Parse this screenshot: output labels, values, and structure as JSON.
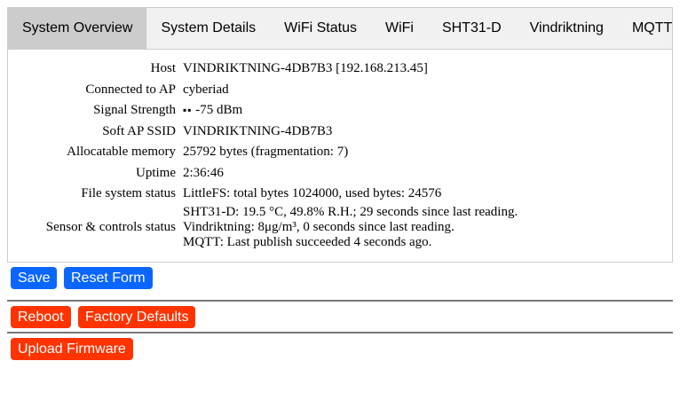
{
  "tabs": [
    {
      "label": "System Overview",
      "active": true
    },
    {
      "label": "System Details",
      "active": false
    },
    {
      "label": "WiFi Status",
      "active": false
    },
    {
      "label": "WiFi",
      "active": false
    },
    {
      "label": "SHT31-D",
      "active": false
    },
    {
      "label": "Vindriktning",
      "active": false
    },
    {
      "label": "MQTT",
      "active": false
    }
  ],
  "overview": {
    "host_label": "Host",
    "host_value": "VINDRIKTNING-4DB7B3 [192.168.213.45]",
    "ap_label": "Connected to AP",
    "ap_value": "cyberiad",
    "signal_label": "Signal Strength",
    "signal_bars": "▪▪",
    "signal_value": "-75 dBm",
    "ssid_label": "Soft AP SSID",
    "ssid_value": "VINDRIKTNING-4DB7B3",
    "memory_label": "Allocatable memory",
    "memory_value": "25792 bytes (fragmentation: 7)",
    "uptime_label": "Uptime",
    "uptime_value": "2:36:46",
    "fs_label": "File system status",
    "fs_value": "LittleFS: total bytes 1024000, used bytes: 24576",
    "sensors_label": "Sensor & controls status",
    "sensors_lines": [
      "SHT31-D: 19.5 °C, 49.8% R.H.; 29 seconds since last reading.",
      "Vindriktning: 8μg/m³, 0 seconds since last reading.",
      "MQTT: Last publish succeeded 4 seconds ago."
    ]
  },
  "buttons": {
    "save": "Save",
    "reset": "Reset Form",
    "reboot": "Reboot",
    "factory": "Factory Defaults",
    "upload": "Upload Firmware"
  },
  "colors": {
    "primary_button": "#0a66ff",
    "danger_button": "#ff3300",
    "active_tab": "#cccccc",
    "tabbar": "#f1f1f1"
  }
}
